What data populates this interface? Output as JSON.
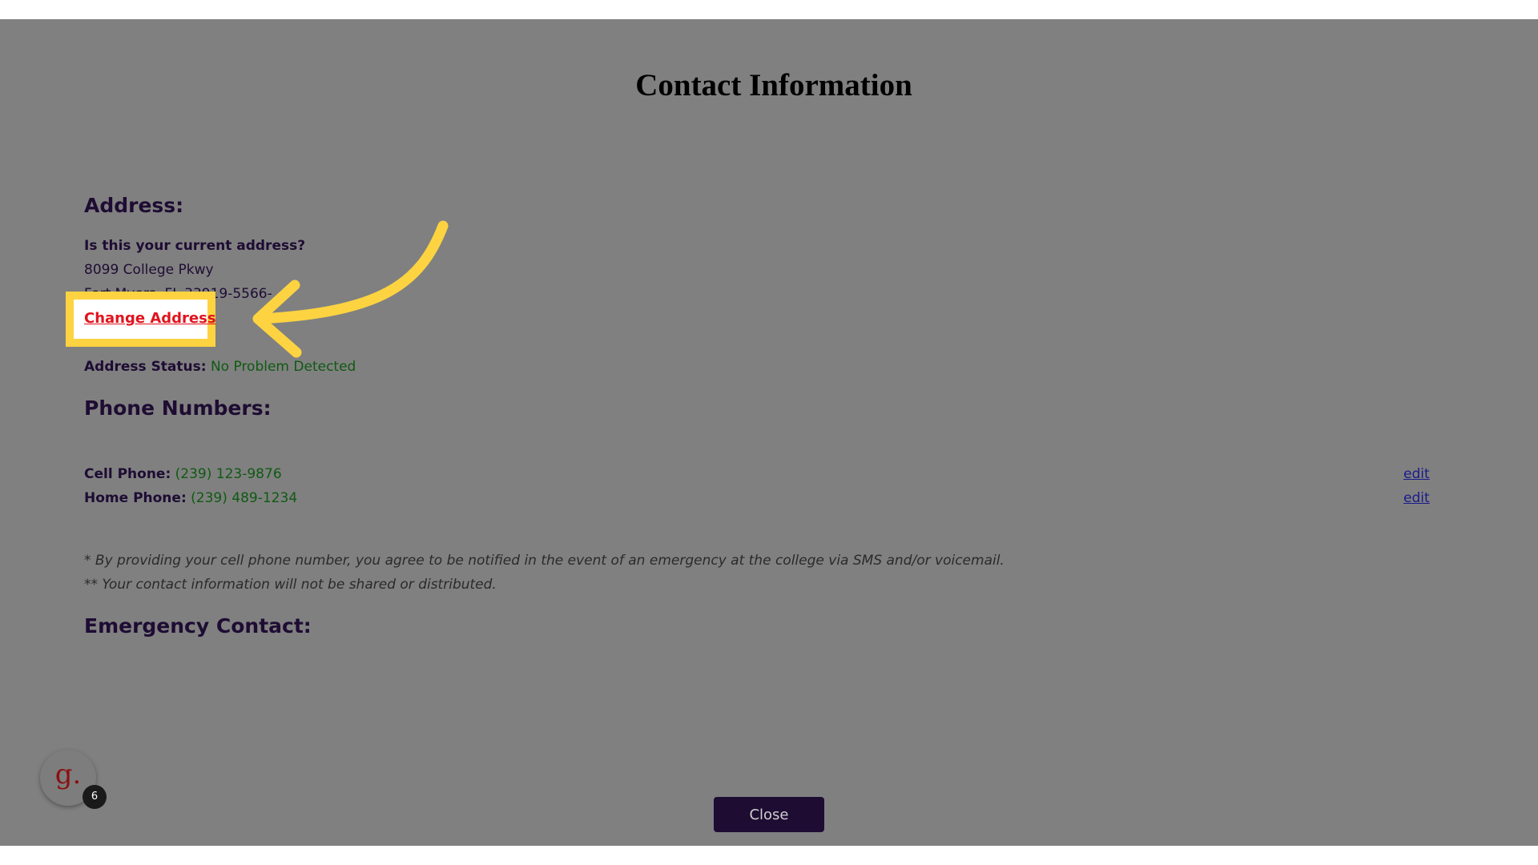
{
  "page": {
    "title": "Contact Information"
  },
  "address": {
    "heading": "Address:",
    "question": "Is this your current address?",
    "line1": "8099 College Pkwy",
    "line2": "Fort Myers, FL 33919-5566-",
    "change_link": "Change Address",
    "status_label": "Address Status:",
    "status_value": "No Problem Detected"
  },
  "phones": {
    "heading": "Phone Numbers:",
    "items": [
      {
        "label": "Cell Phone",
        "value": "(239) 123-9876",
        "edit": "edit"
      },
      {
        "label": "Home Phone",
        "value": "(239) 489-1234",
        "edit": "edit"
      }
    ]
  },
  "notes": {
    "note1": "* By providing your cell phone number, you agree to be notified in the event of an emergency at the college via SMS and/or voicemail.",
    "note2": "** Your contact information will not be shared or distributed."
  },
  "emergency": {
    "heading": "Emergency Contact:"
  },
  "footer": {
    "close_label": "Close"
  },
  "assistant": {
    "icon_letter": "g.",
    "badge_count": "6"
  },
  "colors": {
    "highlight": "#fdd341",
    "link_red": "#e0141e",
    "heading": "#1e0c33",
    "status_green": "#0f5a12"
  },
  "icons": {
    "arrow": "curved-arrow-icon"
  }
}
